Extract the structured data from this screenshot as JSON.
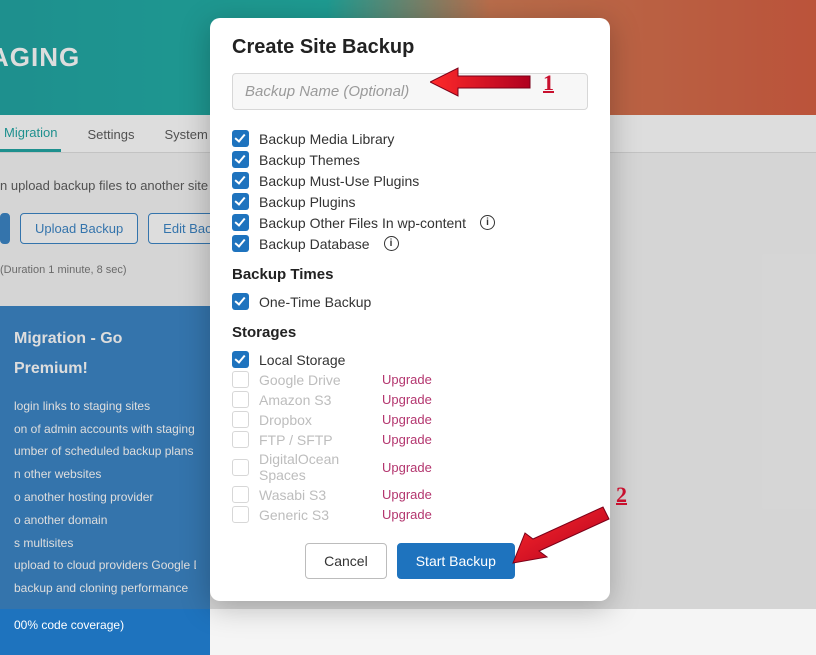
{
  "bg": {
    "banner_title": "AGING",
    "tabs": [
      "Migration",
      "Settings",
      "System Info"
    ],
    "subtext": "n upload backup files to another site to tran",
    "upload_btn": "Upload Backup",
    "edit_btn": "Edit Backu",
    "duration": "(Duration 1 minute, 8 sec)",
    "premium_title": "Migration - Go Premium!",
    "premium_items": [
      "login links to staging sites",
      "on of admin accounts with staging sites",
      "umber of scheduled backup plans",
      "n other websites",
      "o another hosting provider",
      "o another domain",
      "s multisites",
      "upload to cloud providers Google Drive, A",
      "backup and cloning performance",
      "00% code coverage)"
    ]
  },
  "modal": {
    "title": "Create Site Backup",
    "placeholder": "Backup Name (Optional)",
    "options": [
      "Backup Media Library",
      "Backup Themes",
      "Backup Must-Use Plugins",
      "Backup Plugins",
      "Backup Other Files In wp-content",
      "Backup Database"
    ],
    "section_times": "Backup Times",
    "onetime": "One-Time Backup",
    "section_storages": "Storages",
    "local_storage": "Local Storage",
    "upgrade": "Upgrade",
    "disabled_storages": [
      "Google Drive",
      "Amazon S3",
      "Dropbox",
      "FTP / SFTP",
      "DigitalOcean Spaces",
      "Wasabi S3",
      "Generic S3"
    ],
    "cancel": "Cancel",
    "start": "Start Backup"
  },
  "annotations": {
    "one": "1",
    "two": "2"
  }
}
